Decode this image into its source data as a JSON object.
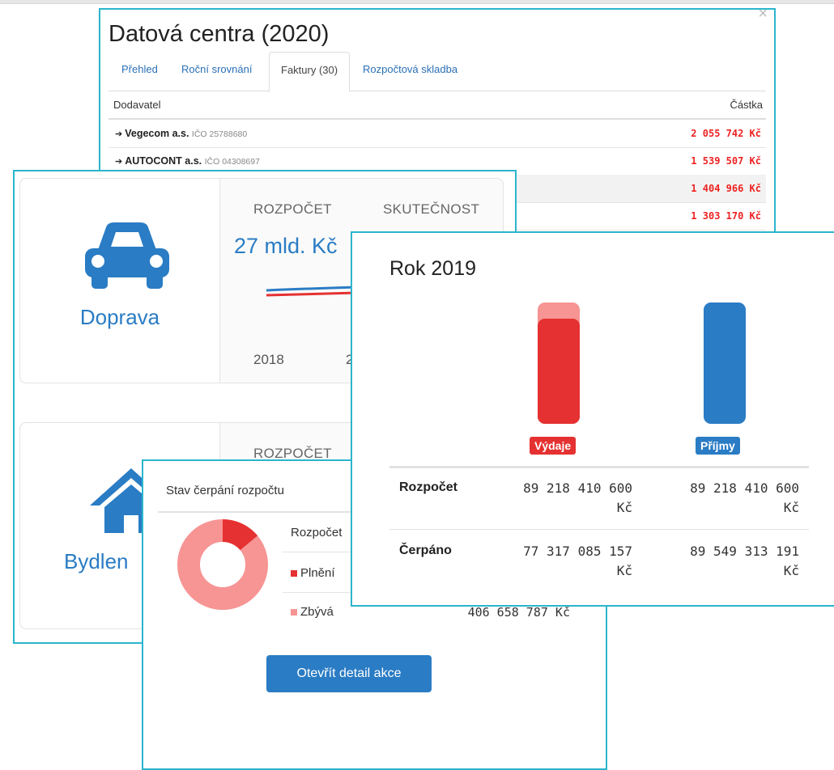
{
  "datacentra": {
    "title": "Datová centra (2020)",
    "close": "×",
    "tabs": [
      "Přehled",
      "Roční srovnání",
      "Faktury (30)",
      "Rozpočtová skladba"
    ],
    "col_supplier": "Dodavatel",
    "col_amount": "Částka",
    "rows": [
      {
        "name": "Vegecom a.s.",
        "ico": "IČO 25788680",
        "amount": "2 055 742 Kč"
      },
      {
        "name": "AUTOCONT a.s.",
        "ico": "IČO 04308697",
        "amount": "1 539 507 Kč"
      },
      {
        "name": "",
        "ico": "",
        "amount": "1 404 966 Kč"
      },
      {
        "name": "",
        "ico": "",
        "amount": "1 303 170 Kč"
      }
    ]
  },
  "doprava": {
    "label": "Doprava",
    "rozpocet_label": "ROZPOČET",
    "skutecnost_label": "SKUTEČNOST",
    "amount": "27 mld. Kč",
    "year_left": "2018",
    "year_right_fragment": "2"
  },
  "bydleni": {
    "label": "Bydlen",
    "rozpocet_label": "ROZPOČET"
  },
  "stav": {
    "title": "Stav čerpání rozpočtu",
    "rozpocet_label": "Rozpočet",
    "plneni_label": "Plnění",
    "zbyva_label": "Zbývá",
    "zbyva_amount": "406 658 787 Kč",
    "button": "Otevřít detail akce",
    "donut": {
      "filled_fraction": 0.14,
      "filled_color": "#e53131",
      "rest_color": "#f79494"
    }
  },
  "rok": {
    "title": "Rok 2019",
    "vydaje_label": "Výdaje",
    "prijmy_label": "Příjmy",
    "rozpocet_label": "Rozpočet",
    "cerpano_label": "Čerpáno",
    "vydaje_rozpocet": "89 218 410 600",
    "prijmy_rozpocet": "89 218 410 600",
    "vydaje_cerpano": "77 317 085 157",
    "prijmy_cerpano": "89 549 313 191",
    "currency": "Kč",
    "colors": {
      "vydaje": "#e53131",
      "vydaje_light": "#f79494",
      "prijmy": "#2a7cc4"
    }
  }
}
